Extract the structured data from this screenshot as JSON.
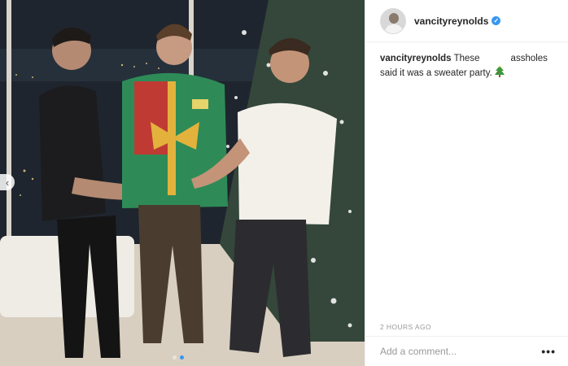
{
  "post": {
    "username": "vancityreynolds",
    "verified": true,
    "caption": {
      "username": "vancityreynolds",
      "text_before": "These",
      "text_after": "assholes",
      "text_line2": "said it was a sweater party.",
      "emoji": "christmas-tree"
    },
    "timestamp": "2 HOURS AGO",
    "comment_placeholder": "Add a comment...",
    "more_label": "•••"
  },
  "carousel": {
    "prev_label": "‹",
    "slide_count": 2,
    "active_slide": 2
  },
  "icons": {
    "verified": "verified-badge-icon",
    "prev": "chevron-left-icon",
    "more": "more-options-icon",
    "emoji": "christmas-tree-icon"
  },
  "colors": {
    "accent": "#3897f0",
    "border": "#efefef",
    "muted": "#999999",
    "text": "#262626"
  }
}
